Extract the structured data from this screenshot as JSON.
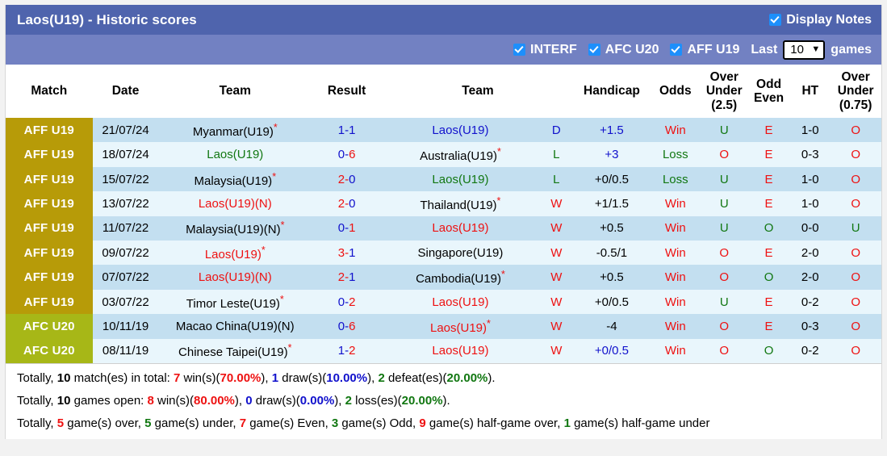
{
  "header": {
    "title": "Laos(U19) - Historic scores",
    "display_notes_label": "Display Notes",
    "filters": [
      {
        "label": "INTERF",
        "checked": true
      },
      {
        "label": "AFC U20",
        "checked": true
      },
      {
        "label": "AFF U19",
        "checked": true
      }
    ],
    "last_label": "Last",
    "games_label": "games",
    "last_value": "10",
    "caret_icon": "chevron-down-icon"
  },
  "table": {
    "columns": [
      "Match",
      "Date",
      "Team",
      "Result",
      "Team",
      "Handicap",
      "Odds",
      "Over Under (2.5)",
      "Odd Even",
      "HT",
      "Over Under (0.75)"
    ],
    "columns_multiline": {
      "over_under_25": [
        "Over",
        "Under",
        "(2.5)"
      ],
      "odd_even": [
        "Odd",
        "Even"
      ],
      "over_under_075": [
        "Over",
        "Under",
        "(0.75)"
      ]
    },
    "rows": [
      {
        "match": "AFF U19",
        "match_type": "aff",
        "date": "21/07/24",
        "home": "Myanmar(U19)",
        "home_color": "black",
        "home_star": true,
        "score_home": "1",
        "score_home_color": "blue",
        "score_away": "1",
        "score_away_color": "blue",
        "away": "Laos(U19)",
        "away_color": "blue",
        "away_star": false,
        "wdl": "D",
        "wdl_color": "blue",
        "handicap": "+1.5",
        "handicap_color": "blue",
        "odds": "Win",
        "odds_color": "red",
        "ou25": "U",
        "ou25_color": "green",
        "oddeven": "E",
        "oddeven_color": "red",
        "ht": "1-0",
        "ou075": "O",
        "ou075_color": "red"
      },
      {
        "match": "AFF U19",
        "match_type": "aff",
        "date": "18/07/24",
        "home": "Laos(U19)",
        "home_color": "green",
        "home_star": false,
        "score_home": "0",
        "score_home_color": "blue",
        "score_away": "6",
        "score_away_color": "red",
        "away": "Australia(U19)",
        "away_color": "black",
        "away_star": true,
        "wdl": "L",
        "wdl_color": "green",
        "handicap": "+3",
        "handicap_color": "blue",
        "odds": "Loss",
        "odds_color": "green",
        "ou25": "O",
        "ou25_color": "red",
        "oddeven": "E",
        "oddeven_color": "red",
        "ht": "0-3",
        "ou075": "O",
        "ou075_color": "red"
      },
      {
        "match": "AFF U19",
        "match_type": "aff",
        "date": "15/07/22",
        "home": "Malaysia(U19)",
        "home_color": "black",
        "home_star": true,
        "score_home": "2",
        "score_home_color": "red",
        "score_away": "0",
        "score_away_color": "blue",
        "away": "Laos(U19)",
        "away_color": "green",
        "away_star": false,
        "wdl": "L",
        "wdl_color": "green",
        "handicap": "+0/0.5",
        "handicap_color": "black",
        "odds": "Loss",
        "odds_color": "green",
        "ou25": "U",
        "ou25_color": "green",
        "oddeven": "E",
        "oddeven_color": "red",
        "ht": "1-0",
        "ou075": "O",
        "ou075_color": "red"
      },
      {
        "match": "AFF U19",
        "match_type": "aff",
        "date": "13/07/22",
        "home": "Laos(U19)(N)",
        "home_color": "red",
        "home_star": false,
        "score_home": "2",
        "score_home_color": "red",
        "score_away": "0",
        "score_away_color": "blue",
        "away": "Thailand(U19)",
        "away_color": "black",
        "away_star": true,
        "wdl": "W",
        "wdl_color": "red",
        "handicap": "+1/1.5",
        "handicap_color": "black",
        "odds": "Win",
        "odds_color": "red",
        "ou25": "U",
        "ou25_color": "green",
        "oddeven": "E",
        "oddeven_color": "red",
        "ht": "1-0",
        "ou075": "O",
        "ou075_color": "red"
      },
      {
        "match": "AFF U19",
        "match_type": "aff",
        "date": "11/07/22",
        "home": "Malaysia(U19)(N)",
        "home_color": "black",
        "home_star": true,
        "score_home": "0",
        "score_home_color": "blue",
        "score_away": "1",
        "score_away_color": "red",
        "away": "Laos(U19)",
        "away_color": "red",
        "away_star": false,
        "wdl": "W",
        "wdl_color": "red",
        "handicap": "+0.5",
        "handicap_color": "black",
        "odds": "Win",
        "odds_color": "red",
        "ou25": "U",
        "ou25_color": "green",
        "oddeven": "O",
        "oddeven_color": "green",
        "ht": "0-0",
        "ou075": "U",
        "ou075_color": "green"
      },
      {
        "match": "AFF U19",
        "match_type": "aff",
        "date": "09/07/22",
        "home": "Laos(U19)",
        "home_color": "red",
        "home_star": true,
        "score_home": "3",
        "score_home_color": "red",
        "score_away": "1",
        "score_away_color": "blue",
        "away": "Singapore(U19)",
        "away_color": "black",
        "away_star": false,
        "wdl": "W",
        "wdl_color": "red",
        "handicap": "-0.5/1",
        "handicap_color": "black",
        "odds": "Win",
        "odds_color": "red",
        "ou25": "O",
        "ou25_color": "red",
        "oddeven": "E",
        "oddeven_color": "red",
        "ht": "2-0",
        "ou075": "O",
        "ou075_color": "red"
      },
      {
        "match": "AFF U19",
        "match_type": "aff",
        "date": "07/07/22",
        "home": "Laos(U19)(N)",
        "home_color": "red",
        "home_star": false,
        "score_home": "2",
        "score_home_color": "red",
        "score_away": "1",
        "score_away_color": "blue",
        "away": "Cambodia(U19)",
        "away_color": "black",
        "away_star": true,
        "wdl": "W",
        "wdl_color": "red",
        "handicap": "+0.5",
        "handicap_color": "black",
        "odds": "Win",
        "odds_color": "red",
        "ou25": "O",
        "ou25_color": "red",
        "oddeven": "O",
        "oddeven_color": "green",
        "ht": "2-0",
        "ou075": "O",
        "ou075_color": "red"
      },
      {
        "match": "AFF U19",
        "match_type": "aff",
        "date": "03/07/22",
        "home": "Timor Leste(U19)",
        "home_color": "black",
        "home_star": true,
        "score_home": "0",
        "score_home_color": "blue",
        "score_away": "2",
        "score_away_color": "red",
        "away": "Laos(U19)",
        "away_color": "red",
        "away_star": false,
        "wdl": "W",
        "wdl_color": "red",
        "handicap": "+0/0.5",
        "handicap_color": "black",
        "odds": "Win",
        "odds_color": "red",
        "ou25": "U",
        "ou25_color": "green",
        "oddeven": "E",
        "oddeven_color": "red",
        "ht": "0-2",
        "ou075": "O",
        "ou075_color": "red"
      },
      {
        "match": "AFC U20",
        "match_type": "afc",
        "date": "10/11/19",
        "home": "Macao China(U19)(N)",
        "home_color": "black",
        "home_star": false,
        "score_home": "0",
        "score_home_color": "blue",
        "score_away": "6",
        "score_away_color": "red",
        "away": "Laos(U19)",
        "away_color": "red",
        "away_star": true,
        "wdl": "W",
        "wdl_color": "red",
        "handicap": "-4",
        "handicap_color": "black",
        "odds": "Win",
        "odds_color": "red",
        "ou25": "O",
        "ou25_color": "red",
        "oddeven": "E",
        "oddeven_color": "red",
        "ht": "0-3",
        "ou075": "O",
        "ou075_color": "red"
      },
      {
        "match": "AFC U20",
        "match_type": "afc",
        "date": "08/11/19",
        "home": "Chinese Taipei(U19)",
        "home_color": "black",
        "home_star": true,
        "score_home": "1",
        "score_home_color": "blue",
        "score_away": "2",
        "score_away_color": "red",
        "away": "Laos(U19)",
        "away_color": "red",
        "away_star": false,
        "wdl": "W",
        "wdl_color": "red",
        "handicap": "+0/0.5",
        "handicap_color": "blue",
        "odds": "Win",
        "odds_color": "red",
        "ou25": "O",
        "ou25_color": "red",
        "oddeven": "O",
        "oddeven_color": "green",
        "ht": "0-2",
        "ou075": "O",
        "ou075_color": "red"
      }
    ]
  },
  "summary": {
    "line1": {
      "prefix": "Totally, ",
      "total": "10",
      "total_suffix": " match(es) in total: ",
      "wins": "7",
      "wins_label": " win(s)(",
      "wins_pct": "70.00%",
      "draws_sep": "), ",
      "draws": "1",
      "draws_label": " draw(s)(",
      "draws_pct": "10.00%",
      "defeats_sep": "), ",
      "defeats": "2",
      "defeats_label": " defeat(es)(",
      "defeats_pct": "20.00%",
      "end": ")."
    },
    "line2": {
      "prefix": "Totally, ",
      "total": "10",
      "total_suffix": " games open: ",
      "wins": "8",
      "wins_label": " win(s)(",
      "wins_pct": "80.00%",
      "draws_sep": "), ",
      "draws": "0",
      "draws_label": " draw(s)(",
      "draws_pct": "0.00%",
      "loss_sep": "), ",
      "losses": "2",
      "losses_label": " loss(es)(",
      "losses_pct": "20.00%",
      "end": ")."
    },
    "line3": {
      "prefix": "Totally, ",
      "over": "5",
      "over_label": " game(s) over, ",
      "under": "5",
      "under_label": " game(s) under, ",
      "even": "7",
      "even_label": " game(s) Even, ",
      "odd": "3",
      "odd_label": " game(s) Odd, ",
      "half_over": "9",
      "half_over_label": " game(s) half-game over, ",
      "half_under": "1",
      "half_under_label": " game(s) half-game under"
    }
  },
  "colors": {
    "titlebar": "#4f64ad",
    "optbar": "#7281c2",
    "aff_badge": "#b79b08",
    "afc_badge": "#a7b717",
    "row_odd": "#c3dff0",
    "row_even": "#e9f6fc",
    "win_red": "#ee1111",
    "draw_blue": "#1111cc",
    "loss_green": "#117711"
  }
}
